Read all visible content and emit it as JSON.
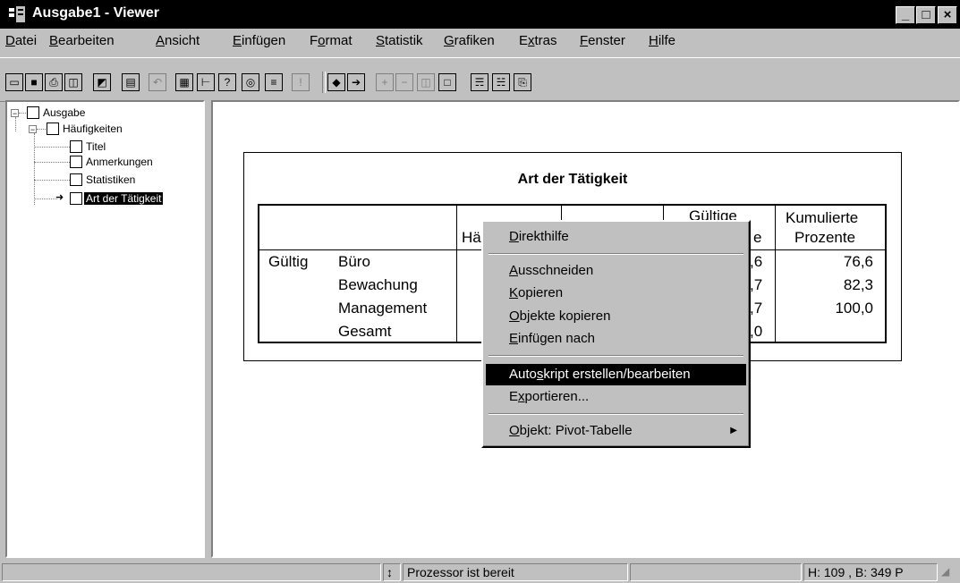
{
  "window": {
    "title": "Ausgabe1 - Viewer",
    "minimize": "_",
    "maximize": "□",
    "close": "×"
  },
  "menubar": [
    {
      "ul": "D",
      "rest": "atei"
    },
    {
      "ul": "B",
      "rest": "earbeiten"
    },
    {
      "ul": "A",
      "rest": "nsicht"
    },
    {
      "ul": "E",
      "rest": "infügen"
    },
    {
      "pre": "F",
      "ul": "o",
      "rest": "rmat"
    },
    {
      "ul": "S",
      "rest": "tatistik"
    },
    {
      "ul": "G",
      "rest": "rafiken"
    },
    {
      "pre": "E",
      "ul": "x",
      "rest": "tras"
    },
    {
      "ul": "F",
      "rest": "enster"
    },
    {
      "ul": "H",
      "rest": "ilfe"
    }
  ],
  "toolbar": {
    "icons": [
      "open-icon",
      "save-icon",
      "print-icon",
      "print-preview-icon",
      "export-icon",
      "goto-data-icon",
      "undo-icon",
      "dialog-recall-icon",
      "goto-case-icon",
      "variables-icon",
      "use-sets-icon",
      "designate-window-icon",
      "run-icon",
      "promote-icon",
      "demote-icon",
      "expand-icon",
      "collapse-icon",
      "show-icon",
      "hide-icon",
      "insert-heading-icon",
      "insert-title-icon",
      "insert-text-icon"
    ]
  },
  "tree": {
    "root": "Ausgabe",
    "group": "Häufigkeiten",
    "children": [
      "Titel",
      "Anmerkungen",
      "Statistiken",
      "Art der Tätigkeit"
    ]
  },
  "pivot": {
    "title": "Art der Tätigkeit",
    "headers": {
      "freq_partial": "Hä",
      "valid_partial": "Gültige",
      "valid_partial2": "e",
      "cumulative_line1": "Kumulierte",
      "cumulative_line2": "Prozente"
    },
    "row_group": "Gültig",
    "rows": [
      {
        "label": "Büro",
        "valid_partial": ",6",
        "cumulative": "76,6"
      },
      {
        "label": "Bewachung",
        "valid_partial": ",7",
        "cumulative": "82,3"
      },
      {
        "label": "Management",
        "valid_partial": ",7",
        "cumulative": "100,0"
      },
      {
        "label": "Gesamt",
        "valid_partial": ",0",
        "cumulative": ""
      }
    ]
  },
  "context_menu": {
    "items": [
      {
        "ul": "D",
        "rest": "irekthilfe"
      },
      {
        "ul": "A",
        "rest": "usschneiden"
      },
      {
        "ul": "K",
        "rest": "opieren"
      },
      {
        "ul": "O",
        "rest": "bjekte kopieren"
      },
      {
        "ul": "E",
        "rest": "infügen nach"
      },
      {
        "pre": "Auto",
        "ul": "s",
        "rest": "kript erstellen/bearbeiten"
      },
      {
        "pre": "E",
        "ul": "x",
        "rest": "portieren..."
      },
      {
        "ul": "O",
        "rest": "bjekt: Pivot-Tabelle"
      }
    ],
    "selected_index": 5
  },
  "statusbar": {
    "message": "Prozessor ist bereit",
    "dims": "H: 109 , B: 349 P"
  },
  "colors": {
    "titlebar": "#000000",
    "face": "#c0c0c0",
    "selection": "#000000"
  }
}
